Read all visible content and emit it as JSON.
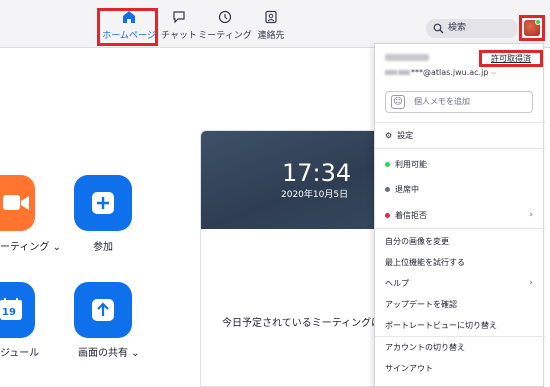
{
  "nav": {
    "tabs": [
      {
        "label": "ホームページ",
        "icon": "home-icon",
        "active": true
      },
      {
        "label": "チャット",
        "icon": "chat-icon",
        "active": false
      },
      {
        "label": "ミーティング",
        "icon": "clock-icon",
        "active": false
      },
      {
        "label": "連絡先",
        "icon": "contacts-icon",
        "active": false
      }
    ],
    "search_label": "検索"
  },
  "main": {
    "tiles": [
      {
        "label": "ーティング",
        "color": "#ff742e",
        "icon": "video-camera-icon"
      },
      {
        "label": "参加",
        "color": "#0e71eb",
        "icon": "plus-icon"
      },
      {
        "label": "ジュール",
        "color": "#0e71eb",
        "icon": "calendar-icon",
        "calendar_day": "19"
      },
      {
        "label": "画面の共有",
        "color": "#0e71eb",
        "icon": "share-up-arrow-icon"
      }
    ],
    "clock": {
      "time": "17:34",
      "date": "2020年10月5日"
    },
    "no_meetings_text": "今日予定されているミーティングはあり"
  },
  "menu": {
    "license_label": "許可取得済",
    "email": "***@atlas.jwu.ac.jp",
    "memo_placeholder": "個人メモを追加",
    "settings_label": "設定",
    "status_items": [
      {
        "label": "利用可能",
        "color": "#23d959"
      },
      {
        "label": "退席中",
        "color": "#6e6e7e"
      },
      {
        "label": "着信拒否",
        "color": "#e8264a"
      }
    ],
    "items": [
      "自分の画像を変更",
      "最上位機能を試行する",
      "ヘルプ",
      "アップデートを確認",
      "ポートレートビューに切り替え",
      "アカウントの切り替え",
      "サインアウト"
    ]
  },
  "colors": {
    "accent": "#0e71eb",
    "highlight_box": "#e0262b",
    "orange": "#ff742e"
  }
}
